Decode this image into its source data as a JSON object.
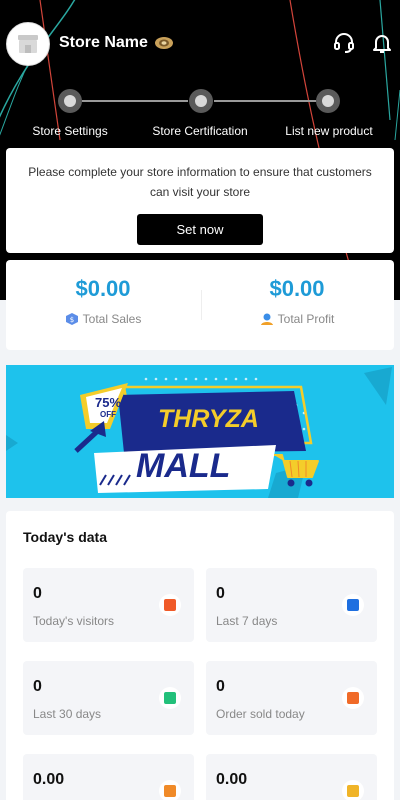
{
  "header": {
    "store_name": "Store Name"
  },
  "steps": [
    {
      "label": "Store Settings"
    },
    {
      "label": "Store Certification"
    },
    {
      "label": "List new product"
    }
  ],
  "notice": {
    "text": "Please complete your store information to ensure that customers can visit your store",
    "button_label": "Set now"
  },
  "totals": {
    "sales": {
      "value": "$0.00",
      "label": "Total Sales"
    },
    "profit": {
      "value": "$0.00",
      "label": "Total Profit"
    }
  },
  "banner": {
    "discount_percent": "75%",
    "discount_off": "OFF",
    "brand_line1": "THRYZA",
    "brand_line2": "MALL"
  },
  "today": {
    "title": "Today's data",
    "tiles": [
      {
        "value": "0",
        "label": "Today's visitors",
        "icon": "chart-icon",
        "color": "#f05a28"
      },
      {
        "value": "0",
        "label": "Last 7 days",
        "icon": "calendar-7-icon",
        "color": "#1e6fe0"
      },
      {
        "value": "0",
        "label": "Last 30 days",
        "icon": "calendar-30-icon",
        "color": "#22c07a"
      },
      {
        "value": "0",
        "label": "Order sold today",
        "icon": "orders-icon",
        "color": "#f06a28"
      },
      {
        "value": "0.00",
        "label": "",
        "icon": "money-icon",
        "color": "#f08a28"
      },
      {
        "value": "0.00",
        "label": "",
        "icon": "coin-icon",
        "color": "#f0b428"
      }
    ]
  },
  "colors": {
    "accent": "#1e9bd7",
    "header_bg": "#000000",
    "banner_bg": "#1ec2ec"
  }
}
